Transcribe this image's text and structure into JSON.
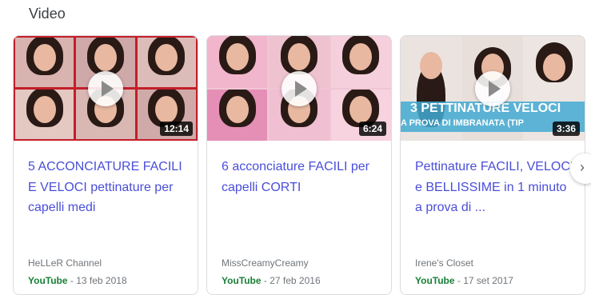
{
  "section": {
    "title": "Video"
  },
  "cards": [
    {
      "duration": "12:14",
      "title": "5 ACCONCIATURE FACILI E VELOCI pettinature per capelli medi",
      "channel": "HeLLeR Channel",
      "source": "YouTube",
      "date_sep": " - ",
      "date": "13 feb 2018"
    },
    {
      "duration": "6:24",
      "title": "6 acconciature FACILI per capelli CORTI",
      "channel": "MissCreamyCreamy",
      "source": "YouTube",
      "date_sep": " - ",
      "date": "27 feb 2016"
    },
    {
      "duration": "3:36",
      "banner_line1": "3 PETTINATURE VELOCI",
      "banner_line2": "A PROVA DI IMBRANATA (TIP",
      "title": "Pettinature FACILI, VELOCI e BELLISSIME in 1 minuto a prova di ...",
      "channel": "Irene's Closet",
      "source": "YouTube",
      "date_sep": " - ",
      "date": "17 set 2017"
    }
  ],
  "next": {
    "icon": "chevron-right-icon",
    "glyph": "›"
  },
  "colors": {
    "title_link": "#4a4ed8",
    "source_green": "#188038",
    "meta_gray": "#70757a",
    "card_border": "#dadce0"
  }
}
